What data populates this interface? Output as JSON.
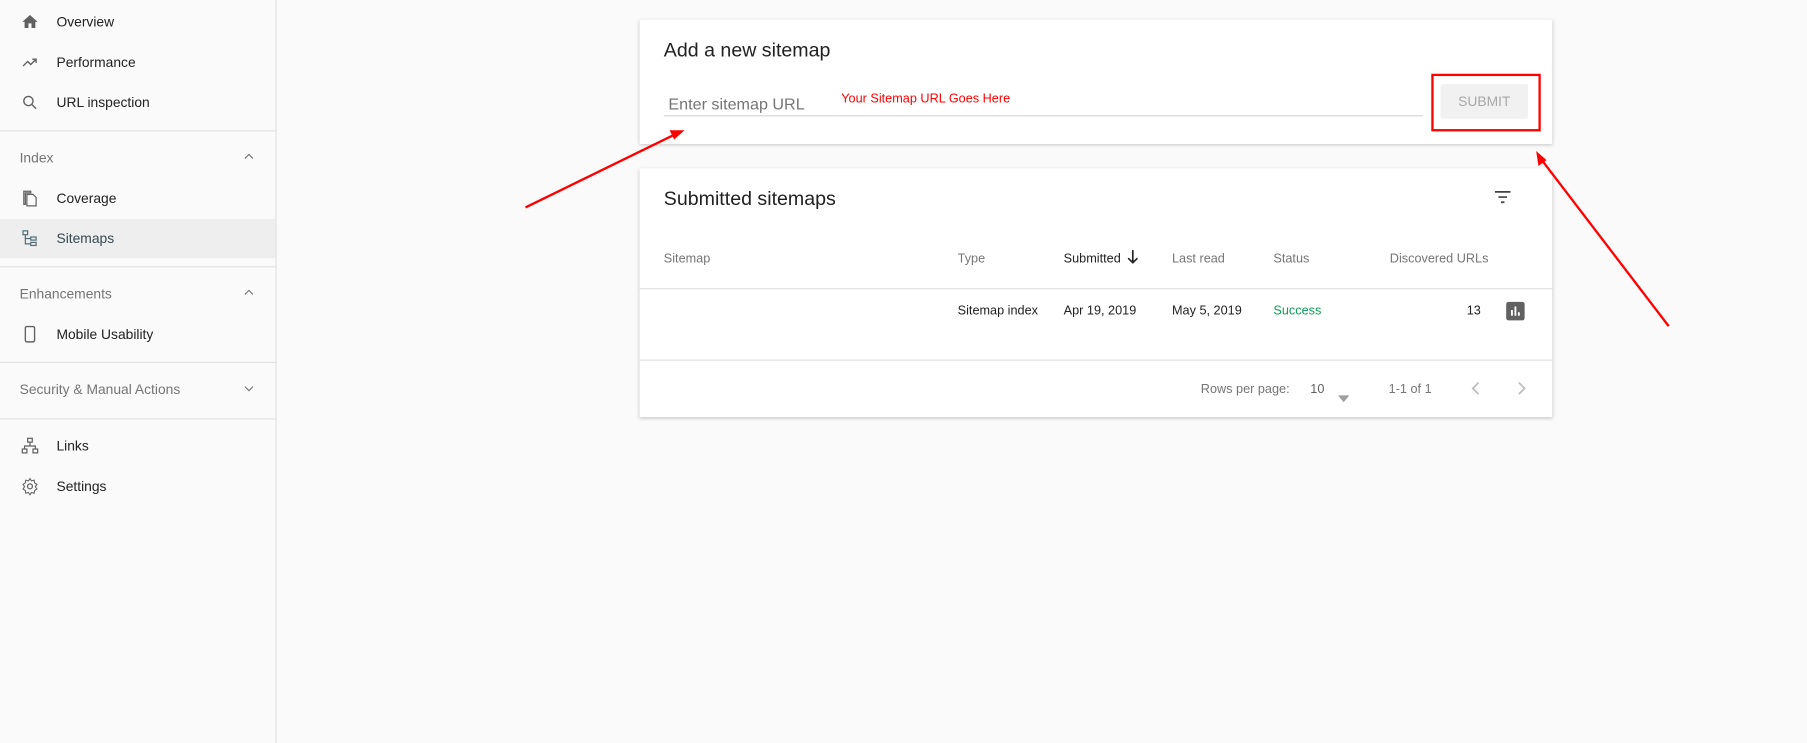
{
  "sidebar": {
    "items_top": [
      {
        "label": "Overview",
        "icon": "home-icon"
      },
      {
        "label": "Performance",
        "icon": "trending-up-icon"
      },
      {
        "label": "URL inspection",
        "icon": "search-icon"
      }
    ],
    "index": {
      "label": "Index",
      "items": [
        {
          "label": "Coverage",
          "icon": "copy-icon"
        },
        {
          "label": "Sitemaps",
          "icon": "sitemap-icon",
          "active": true
        }
      ]
    },
    "enhancements": {
      "label": "Enhancements",
      "items": [
        {
          "label": "Mobile Usability",
          "icon": "phone-icon"
        }
      ]
    },
    "security": {
      "label": "Security & Manual Actions"
    },
    "items_bottom": [
      {
        "label": "Links",
        "icon": "links-icon"
      },
      {
        "label": "Settings",
        "icon": "gear-icon"
      }
    ]
  },
  "add_card": {
    "title": "Add a new sitemap",
    "input_placeholder": "Enter sitemap URL",
    "input_value": "",
    "annotation": "Your Sitemap URL Goes Here",
    "submit_label": "SUBMIT"
  },
  "submitted_card": {
    "title": "Submitted sitemaps",
    "columns": [
      "Sitemap",
      "Type",
      "Submitted",
      "Last read",
      "Status",
      "Discovered URLs"
    ],
    "rows": [
      {
        "sitemap": "",
        "type": "Sitemap index",
        "submitted": "Apr 19, 2019",
        "last_read": "May 5, 2019",
        "status": "Success",
        "discovered": "13"
      }
    ],
    "footer": {
      "rows_per_page_label": "Rows per page:",
      "rows_per_page": "10",
      "range": "1-1 of 1"
    }
  },
  "colors": {
    "success": "#0f9d58",
    "annotation": "#ff0000",
    "accent_text": "#212121"
  }
}
